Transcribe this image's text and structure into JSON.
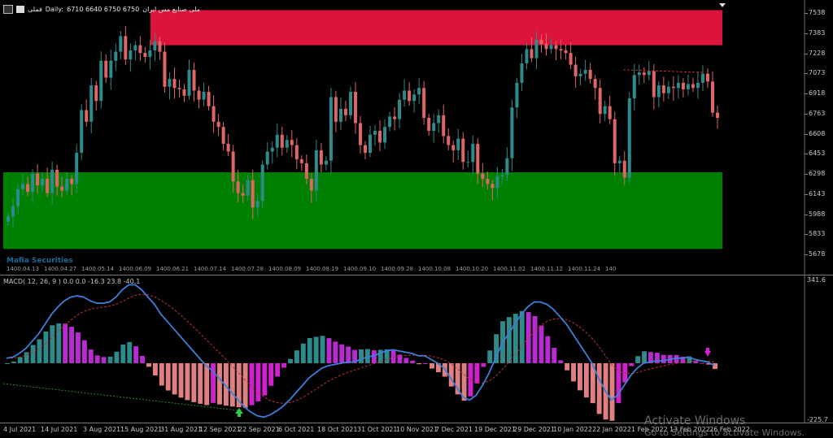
{
  "header": {
    "symbol": "فملی",
    "timeframe": "Daily:",
    "ohlc": "6710 6640 6750 6750",
    "name": "ملی صنایع مس ایران"
  },
  "macd": {
    "label": "MACD( 12, 26, 9 ) 0.0 0.0 -16.3 23.8 -40.1",
    "max_label": "341.6",
    "min_label": "-225.7"
  },
  "price_axis": [
    "7538",
    "7383",
    "7228",
    "7073",
    "6918",
    "6763",
    "6608",
    "6453",
    "6298",
    "6143",
    "5988",
    "5833",
    "5678"
  ],
  "inner_dates": [
    "1400.04.13",
    "1400.04.27",
    "1400.05.14",
    "1400.06.09",
    "1400.06.21",
    "1400.07.14",
    "1400.07.28",
    "1400.08.09",
    "1400.08.19",
    "1400.09.10",
    "1400.09.28",
    "1400.10.08",
    "1400.10.20",
    "1400.11.02",
    "1400.11.12",
    "1400.11.24",
    "140"
  ],
  "bottom_dates": [
    "4 Jul 2021",
    "14 Jul 2021",
    "3 Aug 2021",
    "15 Aug 2021",
    "31 Aug 2021",
    "12 Sep 2021",
    "22 Sep 2021",
    "6 Oct 2021",
    "18 Oct 2021",
    "31 Oct 2021",
    "10 Nov 2021",
    "7 Dec 2021",
    "19 Dec 2021",
    "29 Dec 2021",
    "10 Jan 2022",
    "22 Jan 2022",
    "1 Feb 2022",
    "13 Feb 2022",
    "26 Feb 2022"
  ],
  "overlay_text": "Mafia Securities",
  "watermark": {
    "title": "Activate Windows",
    "subtitle": "Go to Settings to activate Windows."
  },
  "colors": {
    "supply_zone": "#dc143c",
    "demand_zone": "#008000",
    "bull_candle": "#2e8b8b",
    "bear_candle": "#e06666",
    "macd_line": "#3d7fd9",
    "signal_line": "#c03030",
    "hist_pos": "#2e8b8b",
    "hist_pos_strong": "#b82bd0",
    "hist_neg": "#e08080",
    "hist_neg_strong": "#d020d0"
  },
  "chart_data": [
    {
      "type": "candlestick",
      "title": "فملی Daily",
      "ylim": [
        5600,
        7600
      ],
      "y_ticks": [
        7538,
        7383,
        7228,
        7073,
        6918,
        6763,
        6608,
        6453,
        6298,
        6143,
        5988,
        5833,
        5678
      ],
      "zones": [
        {
          "name": "supply",
          "from": 7290,
          "to": 7560
        },
        {
          "name": "demand",
          "from": 5720,
          "to": 6310
        }
      ],
      "closes": [
        5970,
        6050,
        6180,
        6220,
        6160,
        6300,
        6210,
        6260,
        6150,
        6330,
        6200,
        6170,
        6260,
        6220,
        6460,
        6790,
        6700,
        6980,
        6860,
        7170,
        7040,
        7170,
        7240,
        7360,
        7180,
        7250,
        7290,
        7230,
        7200,
        7250,
        7320,
        7240,
        6970,
        7030,
        6960,
        6950,
        6900,
        7100,
        6940,
        6870,
        6930,
        6820,
        6700,
        6660,
        6530,
        6470,
        6240,
        6150,
        6130,
        6250,
        6040,
        6090,
        6370,
        6470,
        6500,
        6600,
        6500,
        6560,
        6520,
        6410,
        6380,
        6260,
        6170,
        6480,
        6370,
        6400,
        6890,
        6700,
        6800,
        6750,
        6930,
        6690,
        6520,
        6460,
        6600,
        6630,
        6540,
        6660,
        6740,
        6720,
        6870,
        6940,
        6860,
        6910,
        6960,
        6730,
        6630,
        6690,
        6750,
        6590,
        6520,
        6480,
        6570,
        6390,
        6390,
        6530,
        6300,
        6260,
        6220,
        6190,
        6280,
        6290,
        6420,
        6810,
        7000,
        7150,
        7260,
        7190,
        7330,
        7300,
        7260,
        7290,
        7260,
        7250,
        7230,
        7140,
        7050,
        7070,
        7100,
        7030,
        6960,
        6760,
        6820,
        6720,
        6380,
        6400,
        6270,
        6880,
        7060,
        7080,
        7060,
        7090,
        6890,
        6980,
        6920,
        6970,
        6960,
        7000,
        6950,
        6990,
        6960,
        7000,
        7070,
        7010,
        6770,
        6730
      ]
    },
    {
      "type": "macd",
      "params": [
        12,
        26,
        9
      ],
      "ylim": [
        -225.7,
        341.6
      ],
      "macd": [
        20,
        25,
        40,
        60,
        90,
        120,
        160,
        200,
        230,
        255,
        270,
        275,
        270,
        255,
        245,
        245,
        250,
        270,
        300,
        320,
        320,
        300,
        270,
        240,
        200,
        170,
        140,
        110,
        80,
        50,
        20,
        -10,
        -30,
        -60,
        -90,
        -120,
        -150,
        -180,
        -200,
        -215,
        -220,
        -210,
        -195,
        -175,
        -150,
        -120,
        -90,
        -60,
        -40,
        -20,
        -10,
        -5,
        0,
        5,
        5,
        15,
        25,
        30,
        40,
        50,
        55,
        50,
        45,
        40,
        30,
        30,
        15,
        0,
        -20,
        -60,
        -100,
        -140,
        -150,
        -130,
        -90,
        -40,
        20,
        80,
        120,
        160,
        200,
        230,
        250,
        250,
        240,
        220,
        190,
        160,
        120,
        80,
        40,
        0,
        -60,
        -110,
        -150,
        -130,
        -90,
        -50,
        -20,
        0,
        5,
        10,
        10,
        15,
        20,
        20,
        25,
        15,
        10,
        5,
        -10
      ]
    }
  ]
}
